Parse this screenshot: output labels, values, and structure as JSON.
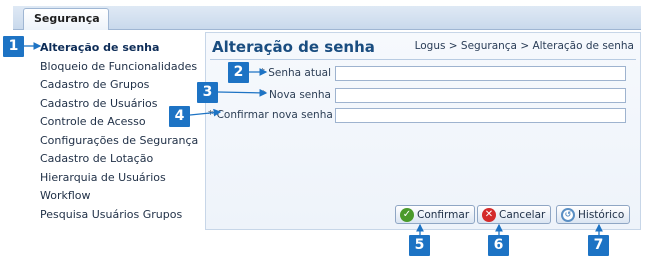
{
  "tab": {
    "label": "Segurança"
  },
  "sidebar": {
    "items": [
      {
        "label": "Alteração de senha",
        "active": true
      },
      {
        "label": "Bloqueio de Funcionalidades"
      },
      {
        "label": "Cadastro de Grupos"
      },
      {
        "label": "Cadastro de Usuários"
      },
      {
        "label": "Controle de Acesso"
      },
      {
        "label": "Configurações de Segurança"
      },
      {
        "label": "Cadastro de Lotação"
      },
      {
        "label": "Hierarquia de Usuários"
      },
      {
        "label": "Workflow"
      },
      {
        "label": "Pesquisa Usuários Grupos"
      }
    ]
  },
  "page": {
    "title": "Alteração de senha",
    "breadcrumb": "Logus > Segurança > Alteração de senha"
  },
  "form": {
    "senha_atual": {
      "label": "* Senha atual",
      "value": ""
    },
    "nova_senha": {
      "label": "* Nova senha",
      "value": ""
    },
    "confirmar_senha": {
      "label": "* Confirmar nova senha",
      "value": ""
    }
  },
  "buttons": {
    "confirmar": {
      "label": "Confirmar",
      "icon": "check-icon",
      "color": "#4a9a2a"
    },
    "cancelar": {
      "label": "Cancelar",
      "icon": "cancel-x-icon",
      "color": "#d42a2a"
    },
    "historico": {
      "label": "Histórico",
      "icon": "history-icon",
      "color": "#5a8fc4"
    }
  },
  "callouts": [
    "1",
    "2",
    "3",
    "4",
    "5",
    "6",
    "7"
  ],
  "accent_color": "#1d73c4"
}
